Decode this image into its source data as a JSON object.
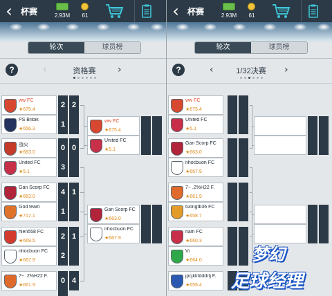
{
  "topbar": {
    "back_icon": "back-arrow-icon",
    "title": "杯赛",
    "money": "2.93M",
    "coins": "61",
    "cart_icon": "shopping-cart-icon",
    "clipboard_icon": "clipboard-icon"
  },
  "tabs": {
    "active": "轮次",
    "inactive": "球员榜"
  },
  "help_label": "?",
  "left": {
    "round_label": "资格赛",
    "round1": [
      {
        "name": "ww FC",
        "rating": "675.4",
        "score": [
          "2",
          "2"
        ],
        "crest": "#d8472f",
        "highlight": true
      },
      {
        "name": "PS Bribik",
        "rating": "656.3",
        "crest": "#24305e",
        "highlight": false
      },
      {
        "name": "战火",
        "rating": "663.0",
        "score": [
          "0",
          "0"
        ],
        "crest": "#c63a2a",
        "highlight": false
      },
      {
        "name": "United FC",
        "rating": "5.1",
        "crest": "#c8304a",
        "highlight": false
      },
      {
        "name": "Gan Scorp FC",
        "rating": "663.0",
        "score": [
          "4",
          "1"
        ],
        "crest": "#b2243a",
        "highlight": false
      },
      {
        "name": "God team",
        "rating": "717.1",
        "crest": "#e0732a",
        "highlight": false
      },
      {
        "name": "hlen558 FC",
        "rating": "669.5",
        "score": [
          "2",
          "1"
        ],
        "crest": "#d43b2f",
        "highlight": false
      },
      {
        "name": "nhocbuon FC",
        "rating": "667.9",
        "crest": "#ffffff",
        "highlight": false
      },
      {
        "name": "7~ .2%H22 F.",
        "rating": "661.9",
        "score": [
          "0",
          "4"
        ],
        "crest": "#e06a2c",
        "highlight": false
      }
    ],
    "second_scores": [
      "1",
      "3",
      "1",
      "2",
      "2"
    ],
    "round2": [
      {
        "name": "ww FC",
        "rating": "675.4",
        "crest": "#d8472f",
        "highlight": true
      },
      {
        "name": "United FC",
        "rating": "5.1",
        "crest": "#c8304a",
        "highlight": false
      },
      {
        "name": "Gan Scorp FC",
        "rating": "663.0",
        "crest": "#b2243a",
        "highlight": false
      },
      {
        "name": "nhocbuon FC",
        "rating": "667.9",
        "crest": "#ffffff",
        "highlight": false
      }
    ]
  },
  "right": {
    "round_label": "1/32决赛",
    "round1": [
      {
        "name": "ww FC",
        "rating": "675.4",
        "crest": "#d8472f",
        "highlight": true
      },
      {
        "name": "United FC",
        "rating": "5.1",
        "crest": "#c8304a",
        "highlight": false
      },
      {
        "name": "Gan Scorp FC",
        "rating": "663.0",
        "crest": "#b2243a",
        "highlight": false
      },
      {
        "name": "nhocbuon FC",
        "rating": "667.9",
        "crest": "#ffffff",
        "highlight": false
      },
      {
        "name": "7~ .2%H22 F.",
        "rating": "661.9",
        "crest": "#e06a2c",
        "highlight": false
      },
      {
        "name": "tuongtb36 FC",
        "rating": "658.7",
        "crest": "#e39b2a",
        "highlight": false
      },
      {
        "name": "nam FC",
        "rating": "660.3",
        "crest": "#c8304a",
        "highlight": false
      },
      {
        "name": "Vi",
        "rating": "664.0",
        "crest": "#2fa84a",
        "highlight": false
      },
      {
        "name": "jpcjkkfdddrtj F.",
        "rating": "659.4",
        "crest": "#2b58b0",
        "highlight": false
      }
    ]
  },
  "logo": {
    "line1": "梦幻",
    "line2": "足球经理"
  },
  "colors": {
    "accent": "#2b3a46",
    "highlight_name": "#e04a2d",
    "rating": "#e08a1e"
  }
}
